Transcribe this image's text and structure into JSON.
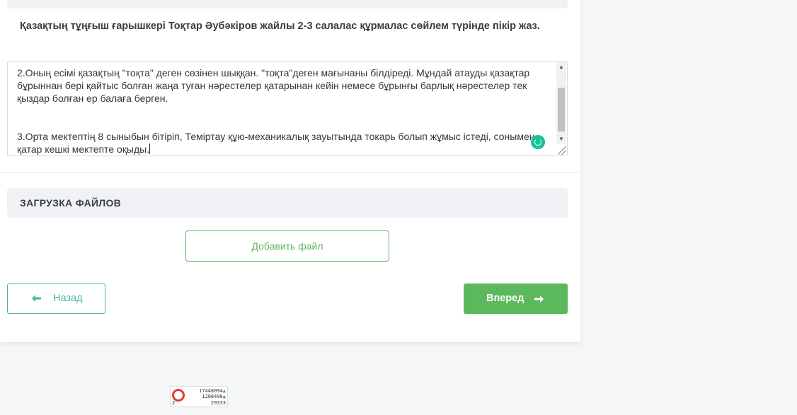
{
  "question": {
    "text": "Қазақтың тұңғыш ғарышкері Тоқтар Әубәкіров жайлы 2-3 салалас құрмалас сөйлем түрінде пікір жаз."
  },
  "answer": {
    "paragraph_2": "2.Оның есімі қазақтың \"тоқта\" деген сөзінен шыққан. \"тоқта\"деген мағынаны білдіреді. Мұндай атауды қазақтар бұрыннан бері қайтыс болған жаңа туған нәрестелер қатарынан кейін немесе бұрынғы барлық нәрестелер тек қыздар болған ер балаға берген.",
    "paragraph_3": "3.Орта мектептің 8 сыныбын бітіріп, Теміртау құю-механикалық зауытында токарь болып жұмыс істеді, сонымен қатар кешкі мектепте оқыды."
  },
  "upload": {
    "title": "ЗАГРУЗКА ФАЙЛОВ",
    "add_file_label": "Добавить файл"
  },
  "navigation": {
    "back_label": "Назад",
    "next_label": "Вперед"
  },
  "widget": {
    "line1": "17448094",
    "line2": "1208490",
    "line3": "29333",
    "left_number": "2"
  },
  "colors": {
    "accent_green": "#5cb85c",
    "accent_teal": "#4fb1a8",
    "grammarly": "#15c39a"
  }
}
